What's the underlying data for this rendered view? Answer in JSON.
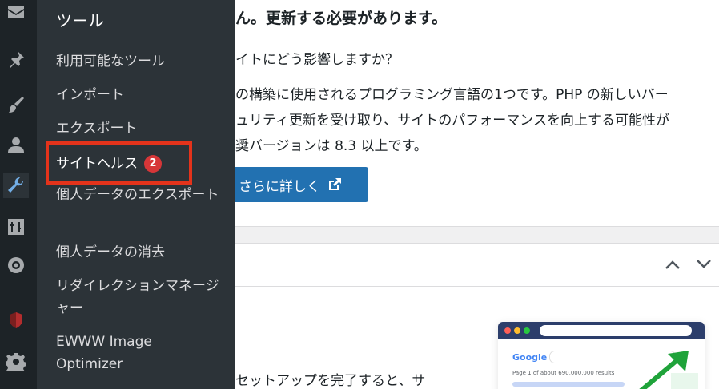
{
  "sidebar_icons": [
    {
      "name": "mail-icon"
    },
    {
      "name": "pin-icon"
    },
    {
      "name": "brush-icon"
    },
    {
      "name": "user-icon"
    },
    {
      "name": "wrench-icon"
    },
    {
      "name": "settings-icon"
    },
    {
      "name": "gear-badge-icon"
    },
    {
      "name": "shield-icon"
    },
    {
      "name": "gear-icon"
    }
  ],
  "submenu": {
    "title": "ツール",
    "items": [
      {
        "label": "利用可能なツール"
      },
      {
        "label": "インポート"
      },
      {
        "label": "エクスポート"
      },
      {
        "label": "サイトヘルス",
        "badge": "2"
      },
      {
        "label": "個人データのエクスポート"
      },
      {
        "label": "個人データの消去"
      },
      {
        "label": "リダイレクションマネージャー"
      },
      {
        "label": "EWWW Image Optimizer"
      }
    ]
  },
  "main": {
    "heading_fragment": "ん。更新する必要があります。",
    "question": "イトにどう影響しますか？",
    "para_line1": "の構築に使用されるプログラミング言語の1つです。PHP の新しいバー",
    "para_line2": "ュリティ更新を受け取り、サイトのパフォーマンスを向上する可能性が",
    "para_line3": "奨バージョンは 8.3 以上です。",
    "learn_more_button": "さらに詳しく",
    "bottom_text": "セットアップを完了すると、サ"
  },
  "illustration": {
    "search_brand": "Google",
    "results_text": "Page 1 of about 690,000,000 results"
  },
  "colors": {
    "sidebar_bg": "#1d2327",
    "submenu_bg": "#2c3338",
    "accent_blue": "#2271b1",
    "badge_red": "#d63638",
    "highlight_red": "#e4331b"
  }
}
